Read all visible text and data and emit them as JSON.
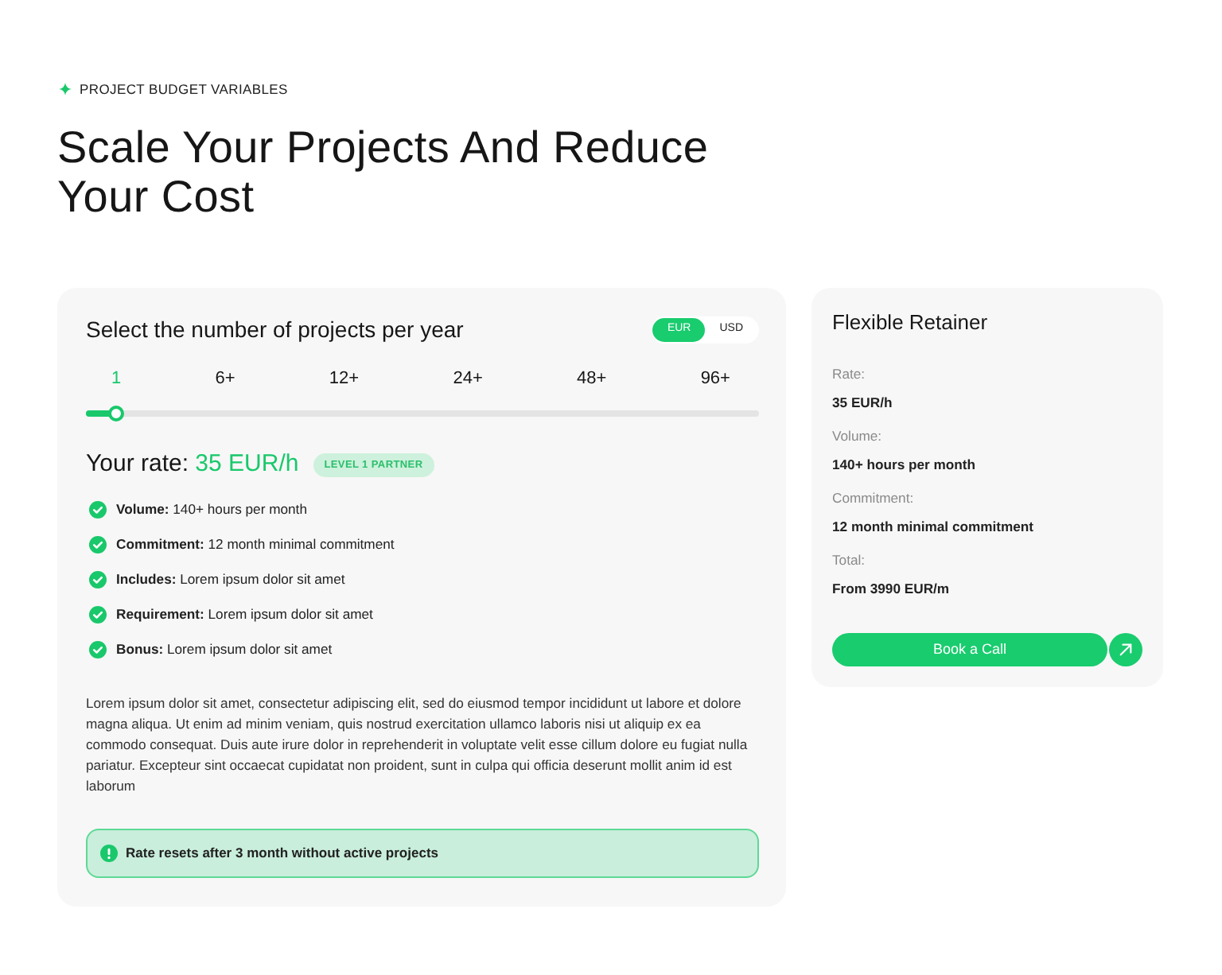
{
  "eyebrow": {
    "text": "PROJECT BUDGET VARIABLES"
  },
  "heading": "Scale Your Projects And Reduce Your Cost",
  "calculator": {
    "title": "Select the number of projects per year",
    "currencies": [
      {
        "label": "EUR",
        "selected": true
      },
      {
        "label": "USD",
        "selected": false
      }
    ],
    "ticks": [
      {
        "label": "1",
        "selected": true
      },
      {
        "label": "6+",
        "selected": false
      },
      {
        "label": "12+",
        "selected": false
      },
      {
        "label": "24+",
        "selected": false
      },
      {
        "label": "48+",
        "selected": false
      },
      {
        "label": "96+",
        "selected": false
      }
    ],
    "slider": {
      "level": 0.045
    },
    "rate": {
      "label": "Your rate:",
      "value": "35 EUR/h",
      "badge": "LEVEL 1 PARTNER"
    },
    "features": [
      {
        "label": "Volume:",
        "value": "140+ hours per month"
      },
      {
        "label": "Commitment:",
        "value": "12 month minimal commitment"
      },
      {
        "label": "Includes:",
        "value": "Lorem ipsum dolor sit amet"
      },
      {
        "label": "Requirement:",
        "value": "Lorem ipsum dolor sit amet"
      },
      {
        "label": "Bonus:",
        "value": "Lorem ipsum dolor sit amet"
      }
    ],
    "description": "Lorem ipsum dolor sit amet, consectetur adipiscing elit, sed do eiusmod tempor incididunt ut labore et dolore magna aliqua. Ut enim ad minim veniam, quis nostrud exercitation ullamco laboris nisi ut aliquip ex ea commodo consequat. Duis aute irure dolor in reprehenderit in voluptate velit esse cillum dolore eu fugiat nulla pariatur. Excepteur sint occaecat cupidatat non proident, sunt in culpa qui officia deserunt mollit anim id est laborum",
    "notice": {
      "text": "Rate resets after 3 month without active projects"
    }
  },
  "summary": {
    "title": "Flexible Retainer",
    "fields": [
      {
        "label": "Rate:",
        "value": "35 EUR/h"
      },
      {
        "label": "Volume:",
        "value": "140+ hours per month"
      },
      {
        "label": "Commitment:",
        "value": "12 month minimal commitment"
      },
      {
        "label": "Total:",
        "value": "From 3990 EUR/m"
      }
    ],
    "button": {
      "label": "Book a Call"
    }
  }
}
